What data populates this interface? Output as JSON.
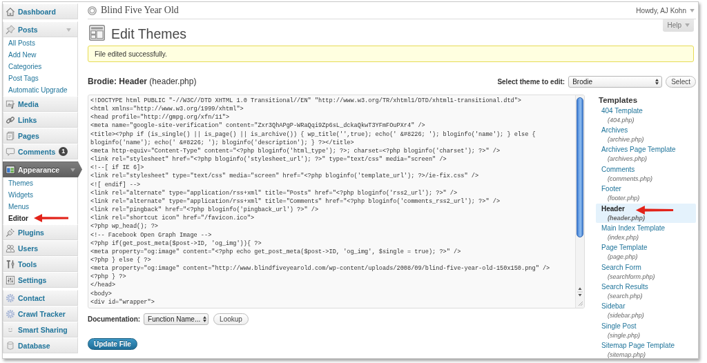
{
  "header": {
    "site_title": "Blind Five Year Old",
    "greeting": "Howdy, AJ Kohn",
    "help": "Help"
  },
  "sidebar": {
    "groups": [
      {
        "items": [
          {
            "label": "Dashboard",
            "selected": false,
            "expanded": false
          }
        ]
      },
      {
        "items": [
          {
            "label": "Posts",
            "selected": false,
            "expanded": true,
            "children": [
              {
                "label": "All Posts",
                "selected": false,
                "annotated": false
              },
              {
                "label": "Add New",
                "selected": false,
                "annotated": false
              },
              {
                "label": "Categories",
                "selected": false,
                "annotated": false
              },
              {
                "label": "Post Tags",
                "selected": false,
                "annotated": false
              },
              {
                "label": "Automatic Upgrade",
                "selected": false,
                "annotated": false
              }
            ]
          },
          {
            "label": "Media",
            "selected": false,
            "expanded": false
          },
          {
            "label": "Links",
            "selected": false,
            "expanded": false
          },
          {
            "label": "Pages",
            "selected": false,
            "expanded": false
          },
          {
            "label": "Comments",
            "selected": false,
            "expanded": false,
            "badge": "1"
          }
        ]
      },
      {
        "items": [
          {
            "label": "Appearance",
            "selected": true,
            "expanded": true,
            "children": [
              {
                "label": "Themes",
                "selected": false,
                "annotated": false
              },
              {
                "label": "Widgets",
                "selected": false,
                "annotated": false
              },
              {
                "label": "Menus",
                "selected": false,
                "annotated": false
              },
              {
                "label": "Editor",
                "selected": true,
                "annotated": true
              }
            ]
          },
          {
            "label": "Plugins",
            "selected": false,
            "expanded": false
          },
          {
            "label": "Users",
            "selected": false,
            "expanded": false
          },
          {
            "label": "Tools",
            "selected": false,
            "expanded": false
          },
          {
            "label": "Settings",
            "selected": false,
            "expanded": false
          }
        ]
      },
      {
        "items": [
          {
            "label": "Contact",
            "selected": false,
            "expanded": false
          },
          {
            "label": "Crawl Tracker",
            "selected": false,
            "expanded": false
          },
          {
            "label": "Smart Sharing",
            "selected": false,
            "expanded": false
          },
          {
            "label": "Database",
            "selected": false,
            "expanded": false
          }
        ]
      }
    ]
  },
  "page": {
    "title": "Edit Themes",
    "notice": "File edited successfully.",
    "file_heading": "**Brodie: Header** (header.php)",
    "theme_select": {
      "label": "Select theme to edit:",
      "value": "Brodie",
      "button": "Select"
    },
    "code_lines": [
      "<!DOCTYPE html PUBLIC \"-//W3C//DTD XHTML 1.0 Transitional//EN\" \"http://www.w3.org/TR/xhtml1/DTD/xhtml1-transitional.dtd\">",
      "<html xmlns=\"http://www.w3.org/1999/xhtml\">",
      "<head profile=\"http://gmpg.org/xfn/11\">",
      "<meta name=\"google-site-verification\" content=\"Zxr3QhAPgP-WRaQqi9Zp6sL_dckaQkwT3YFmFOuPXr4\" />",
      "<title><?php if (is_single() || is_page() || is_archive()) { wp_title('',true); echo(' &#8226; '); bloginfo('name'); } else {",
      "bloginfo('name'); echo(' &#8226; '); bloginfo('description'); } ?></title>",
      "<meta http-equiv=\"Content-Type\" content=\"<?php bloginfo('html_type'); ?>; charset=<?php bloginfo('charset'); ?>\" />",
      "<link rel=\"stylesheet\" href=\"<?php bloginfo('stylesheet_url'); ?>\" type=\"text/css\" media=\"screen\" />",
      "<!--[ if IE 6]>",
      "<link rel=\"stylesheet\" type=\"text/css\" media=\"screen\" href=\"<?php bloginfo('template_url'); ?>/ie-fix.css\" />",
      "<![ endif] -->",
      "<link rel=\"alternate\" type=\"application/rss+xml\" title=\"Posts\" href=\"<?php bloginfo('rss2_url'); ?>\" />",
      "<link rel=\"alternate\" type=\"application/rss+xml\" title=\"Comments\" href=\"<?php bloginfo('comments_rss2_url'); ?>\" />",
      "<link rel=\"pingback\" href=\"<?php bloginfo('pingback_url') ?>\" />",
      "<link rel=\"shortcut icon\" href=\"/favicon.ico\">",
      "<?php wp_head(); ?>",
      "<!-- Facebook Open Graph Image -->",
      "<?php if(get_post_meta($post->ID, 'og_img')){ ?>",
      "<meta property=\"og:image\" content=\"<?php echo get_post_meta($post->ID, 'og_img', $single = true); ?>\" />",
      "<?php } else { ?>",
      "<meta property=\"og:image\" content=\"http://www.blindfiveyearold.com/wp-content/uploads/2008/09/blind-five-year-old-150x150.png\" />",
      "<?php } ?>",
      "</head>",
      "<body>",
      "<div id=\"wrapper\">"
    ],
    "documentation": {
      "label": "Documentation:",
      "value": "Function Name...",
      "button": "Lookup"
    },
    "submit": "Update File"
  },
  "templates": {
    "heading": "Templates",
    "items": [
      {
        "name": "404 Template",
        "file": "(404.php)",
        "selected": false,
        "annotated": false
      },
      {
        "name": "Archives",
        "file": "(archive.php)",
        "selected": false,
        "annotated": false
      },
      {
        "name": "Archives Page Template",
        "file": "(archives.php)",
        "selected": false,
        "annotated": false
      },
      {
        "name": "Comments",
        "file": "(comments.php)",
        "selected": false,
        "annotated": false
      },
      {
        "name": "Footer",
        "file": "(footer.php)",
        "selected": false,
        "annotated": false
      },
      {
        "name": "Header",
        "file": "(header.php)",
        "selected": true,
        "annotated": true
      },
      {
        "name": "Main Index Template",
        "file": "(index.php)",
        "selected": false,
        "annotated": false
      },
      {
        "name": "Page Template",
        "file": "(page.php)",
        "selected": false,
        "annotated": false
      },
      {
        "name": "Search Form",
        "file": "(searchform.php)",
        "selected": false,
        "annotated": false
      },
      {
        "name": "Search Results",
        "file": "(search.php)",
        "selected": false,
        "annotated": false
      },
      {
        "name": "Sidebar",
        "file": "(sidebar.php)",
        "selected": false,
        "annotated": false
      },
      {
        "name": "Single Post",
        "file": "(single.php)",
        "selected": false,
        "annotated": false
      },
      {
        "name": "Sitemap Page Template",
        "file": "(sitemap.php)",
        "selected": false,
        "annotated": false
      }
    ]
  }
}
